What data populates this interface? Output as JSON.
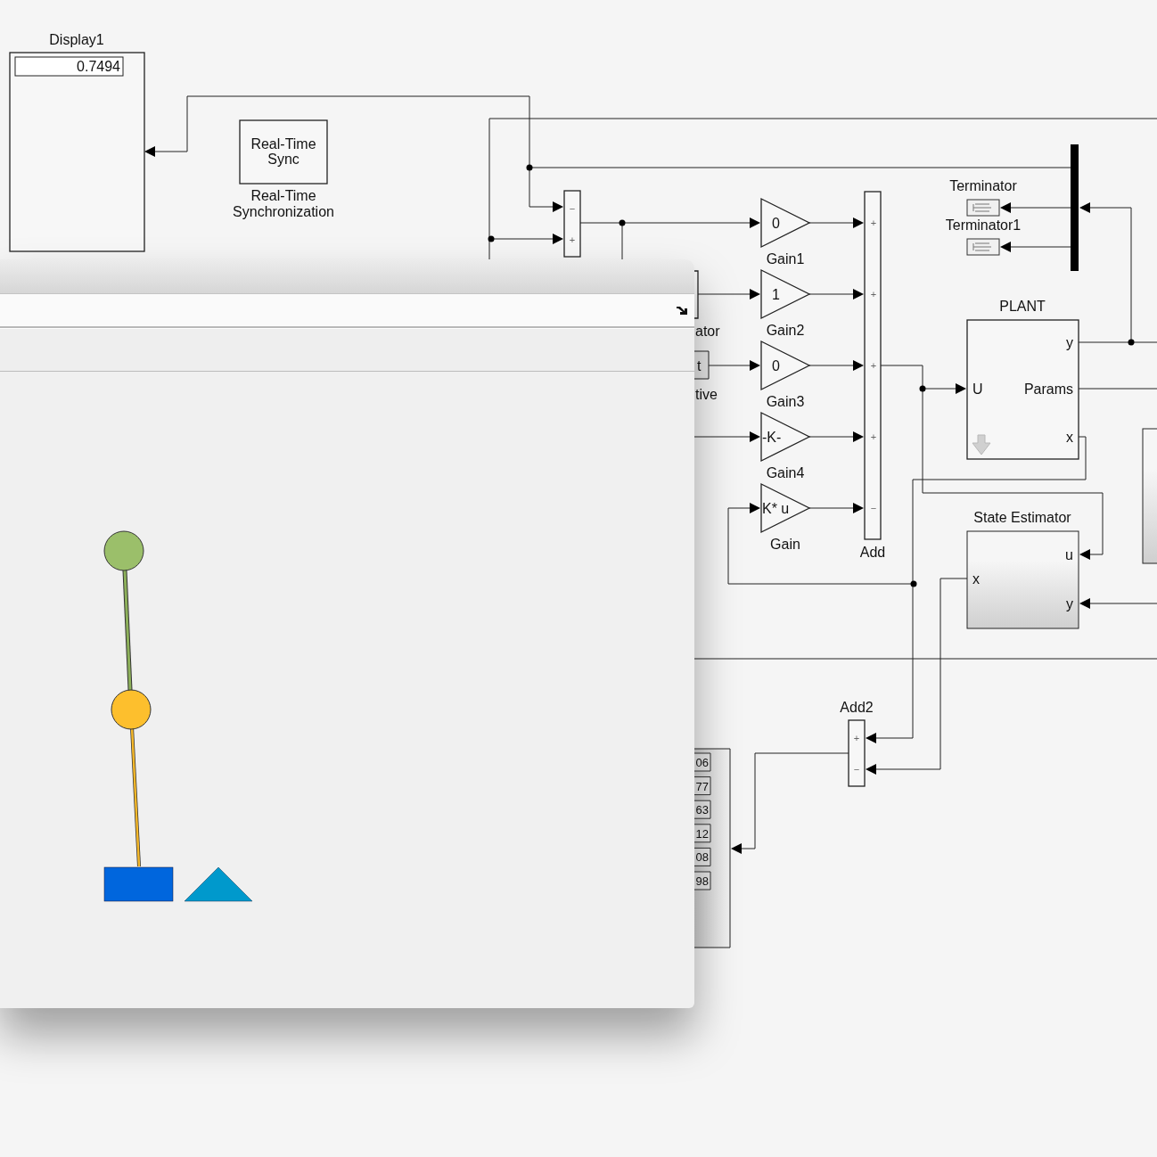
{
  "display": {
    "label": "Display1",
    "value": "0.7494"
  },
  "sync_block": {
    "text": [
      "Real-Time",
      "Sync"
    ],
    "label": [
      "Real-Time",
      "Synchronization"
    ]
  },
  "sum_block": {
    "signs": [
      "−",
      "+"
    ]
  },
  "integrator_label": "ator",
  "derivative_block": {
    "text": "t",
    "label": "tive"
  },
  "gains": [
    {
      "value": "0",
      "label": "Gain1"
    },
    {
      "value": "1",
      "label": "Gain2"
    },
    {
      "value": "0",
      "label": "Gain3"
    },
    {
      "value": "-K-",
      "label": "Gain4"
    },
    {
      "value": "K* u",
      "label": "Gain"
    }
  ],
  "add": {
    "label": "Add",
    "signs": [
      "+",
      "+",
      "+",
      "+",
      "−"
    ]
  },
  "terminators": [
    {
      "label": "Terminator"
    },
    {
      "label": "Terminator1"
    }
  ],
  "plant": {
    "label": "PLANT",
    "input": "U",
    "outputs": [
      "y",
      "Params",
      "x"
    ]
  },
  "state_estimator": {
    "label": "State Estimator",
    "input": "x",
    "ports": [
      "u",
      "y"
    ]
  },
  "add2": {
    "label": "Add2",
    "signs": [
      "+",
      "−"
    ]
  },
  "display_values": [
    "06",
    "77",
    "63",
    "12",
    "08",
    "98"
  ]
}
